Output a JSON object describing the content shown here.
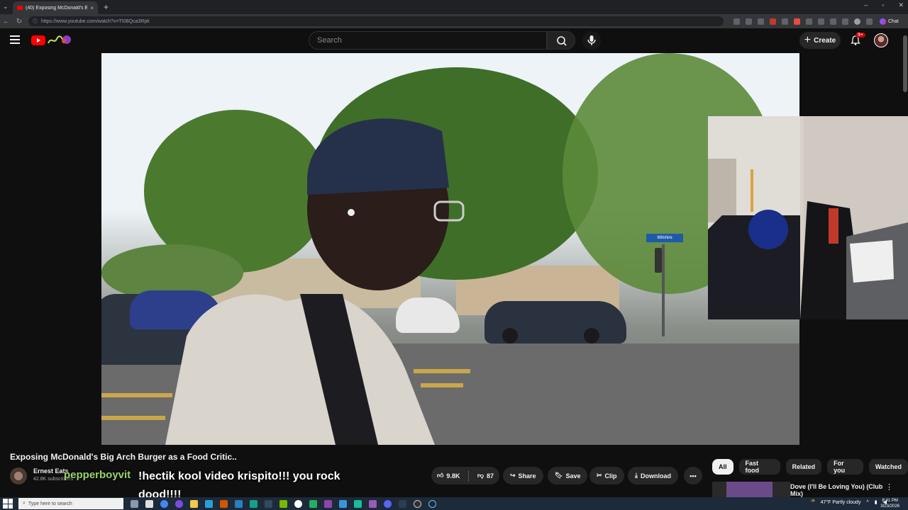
{
  "browser": {
    "tab_title": "(40) Exposing McDonald's Bi",
    "tab_close": "×",
    "new_tab": "+",
    "url": "https://www.youtube.com/watch?v=TI08Qca3Rpk",
    "chat_label": "Chat"
  },
  "youtube": {
    "search_placeholder": "Search",
    "create_label": "Create",
    "notifications_badge": "9+"
  },
  "video": {
    "title": "Exposing McDonald's Big Arch Burger as a Food Critic..",
    "channel_name": "Ernest Eats",
    "subscribers": "42.8K subscribers",
    "street_sign": "Wilshire"
  },
  "overlay_chat": {
    "username": "pepperboyvit",
    "message": "!hectik kool video krispito!!! you rock dood!!!!"
  },
  "actions": {
    "likes": "9.8K",
    "dislikes": "87",
    "share": "Share",
    "save": "Save",
    "clip": "Clip",
    "download": "Download",
    "more": "•••"
  },
  "chips": [
    "All",
    "Fast food",
    "Related",
    "For you",
    "Watched"
  ],
  "recommendation": {
    "title": "Dove (I'll Be Loving You) (Club Mix)",
    "kebab": "⋮"
  },
  "taskbar": {
    "search_placeholder": "Type here to search",
    "weather": "47°F Partly cloudy",
    "time": "8:41 PM",
    "date": "3/23/2026"
  }
}
